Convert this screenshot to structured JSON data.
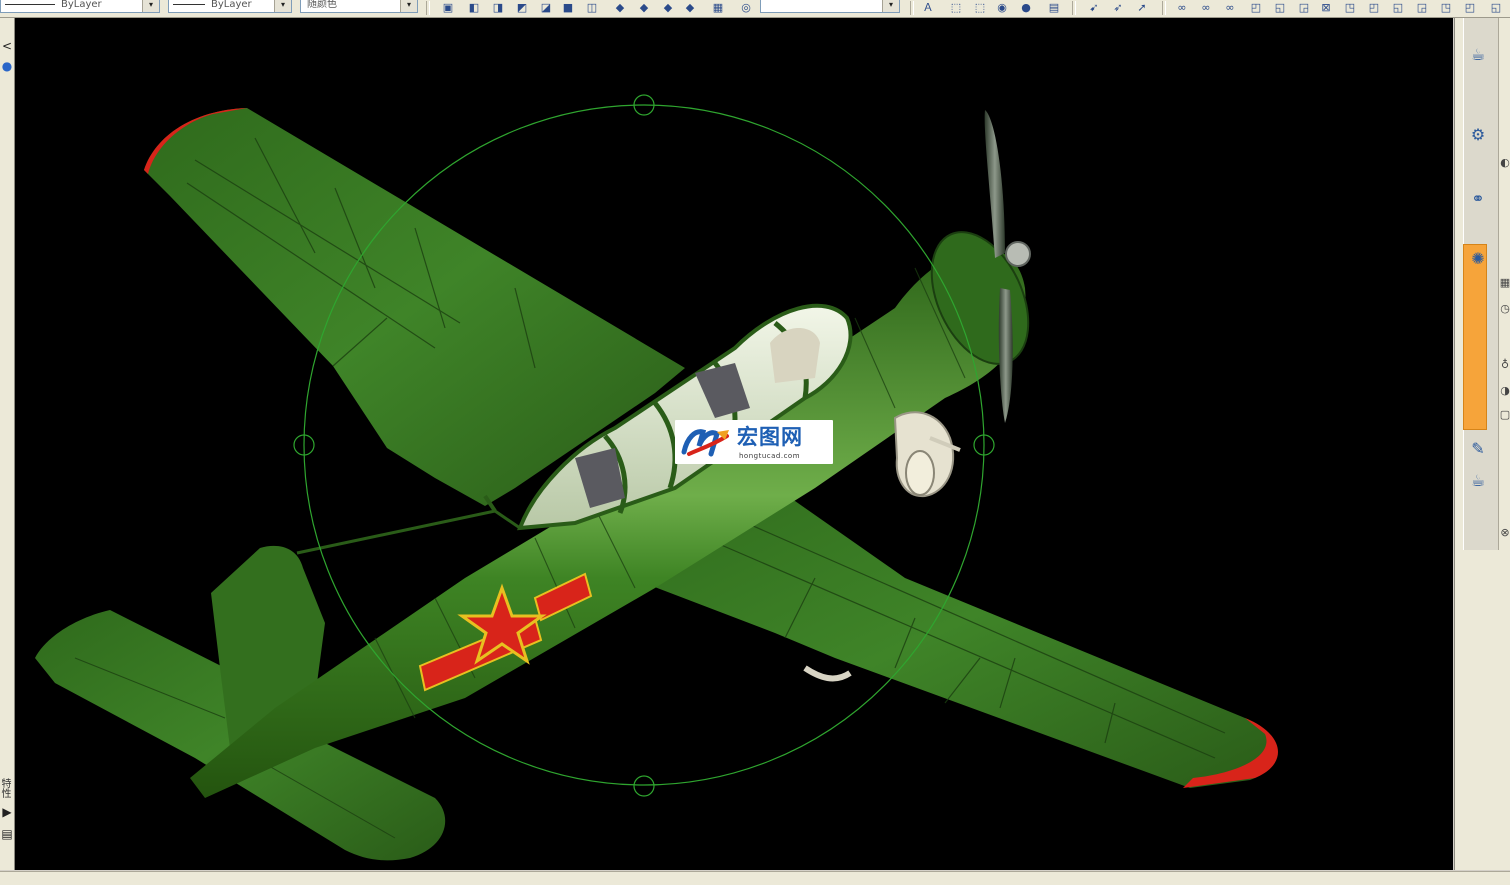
{
  "toolbar": {
    "linetype_value": "ByLayer",
    "lineweight_value": "ByLayer",
    "color_value": "随颜色",
    "dropdown_arrow": "▾",
    "icons": [
      "view-front-icon",
      "view-back-icon",
      "view-left-icon",
      "view-right-icon",
      "view-top-icon",
      "view-bottom-icon",
      "iso-sw-icon",
      "iso-se-icon",
      "iso-ne-icon",
      "iso-nw-icon",
      "camera-icon",
      "orbit-icon",
      "text-icon",
      "solid-icon",
      "box-icon",
      "render-icon",
      "material-icon",
      "mirror-icon",
      "rotate-icon",
      "visibility-icon",
      "layer-off-icon",
      "layer-freeze-icon",
      "layer-lock-icon",
      "layer-state-icon",
      "layer-iso-icon",
      "layer-delete-icon",
      "layer-match-icon",
      "layer-walk-icon"
    ]
  },
  "left_strip": {
    "arrow": "<",
    "vertical_text": "特性",
    "bottom_icons": [
      "▶",
      "▤"
    ]
  },
  "watermark": {
    "name_cn": "宏图网",
    "domain": "hongtucad.com"
  },
  "right_panel": {
    "icons": [
      "teapot-icon",
      "wrench-icon",
      "spheres-icon",
      "light-icon",
      "table-icon",
      "clock-icon",
      "bulb-icon",
      "contrast-icon",
      "square-icon",
      "brush-icon",
      "teapot-small-icon",
      "close-small-icon"
    ]
  },
  "colors": {
    "viewport_bg": "#000000",
    "airplane_green": "#3a7a22",
    "roundel_red": "#d8241a",
    "star_yellow": "#e8c020",
    "orbit_circle": "#2fa52f",
    "palette_tab": "#f6a43a"
  }
}
